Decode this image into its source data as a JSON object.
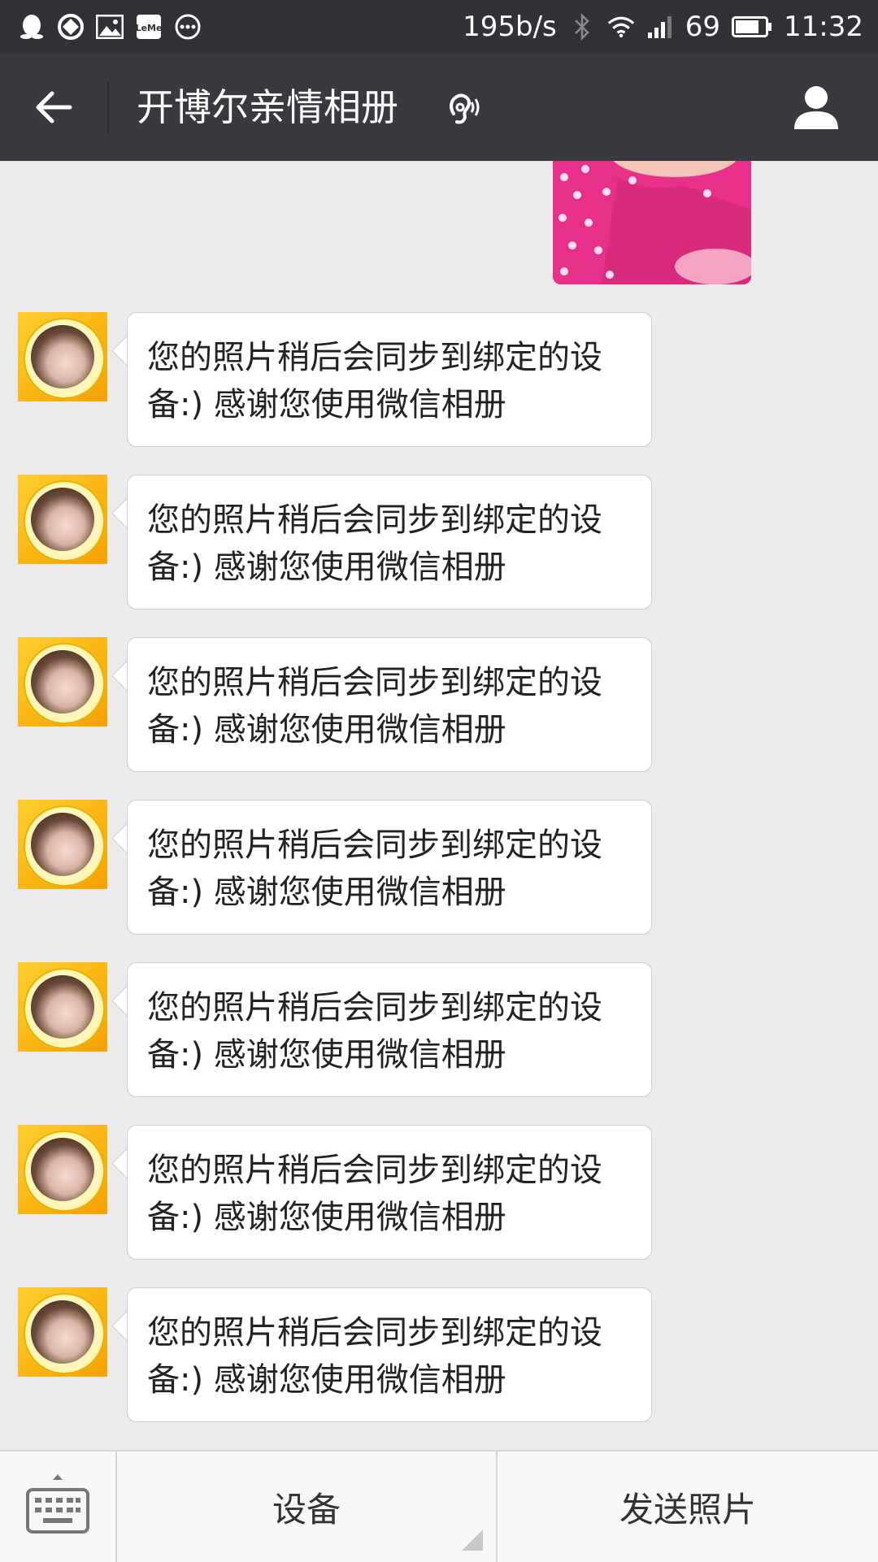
{
  "status_bar": {
    "net_speed": "195b/s",
    "battery": "69",
    "time": "11:32",
    "icons": [
      "qq-icon",
      "sync-icon",
      "gallery-icon",
      "leme-icon",
      "more-icon",
      "bluetooth-icon",
      "wifi-icon",
      "signal-icon",
      "battery-icon"
    ]
  },
  "header": {
    "title": "开博尔亲情相册",
    "back_icon": "back-arrow-icon",
    "ear_icon": "ear-icon",
    "profile_icon": "profile-icon"
  },
  "messages": [
    {
      "sender": "bot",
      "text": "您的照片稍后会同步到绑定的设备:) 感谢您使用微信相册"
    },
    {
      "sender": "bot",
      "text": "您的照片稍后会同步到绑定的设备:) 感谢您使用微信相册"
    },
    {
      "sender": "bot",
      "text": "您的照片稍后会同步到绑定的设备:) 感谢您使用微信相册"
    },
    {
      "sender": "bot",
      "text": "您的照片稍后会同步到绑定的设备:) 感谢您使用微信相册"
    },
    {
      "sender": "bot",
      "text": "您的照片稍后会同步到绑定的设备:) 感谢您使用微信相册"
    },
    {
      "sender": "bot",
      "text": "您的照片稍后会同步到绑定的设备:) 感谢您使用微信相册"
    },
    {
      "sender": "bot",
      "text": "您的照片稍后会同步到绑定的设备:) 感谢您使用微信相册"
    }
  ],
  "bottom_bar": {
    "keyboard_icon": "keyboard-icon",
    "menu_device": "设备",
    "menu_send_photo": "发送照片"
  },
  "colors": {
    "status_bar_bg": "#313236",
    "title_bar_bg": "#393a3f",
    "chat_bg": "#ebebeb",
    "avatar_bg": "#f6a100"
  }
}
